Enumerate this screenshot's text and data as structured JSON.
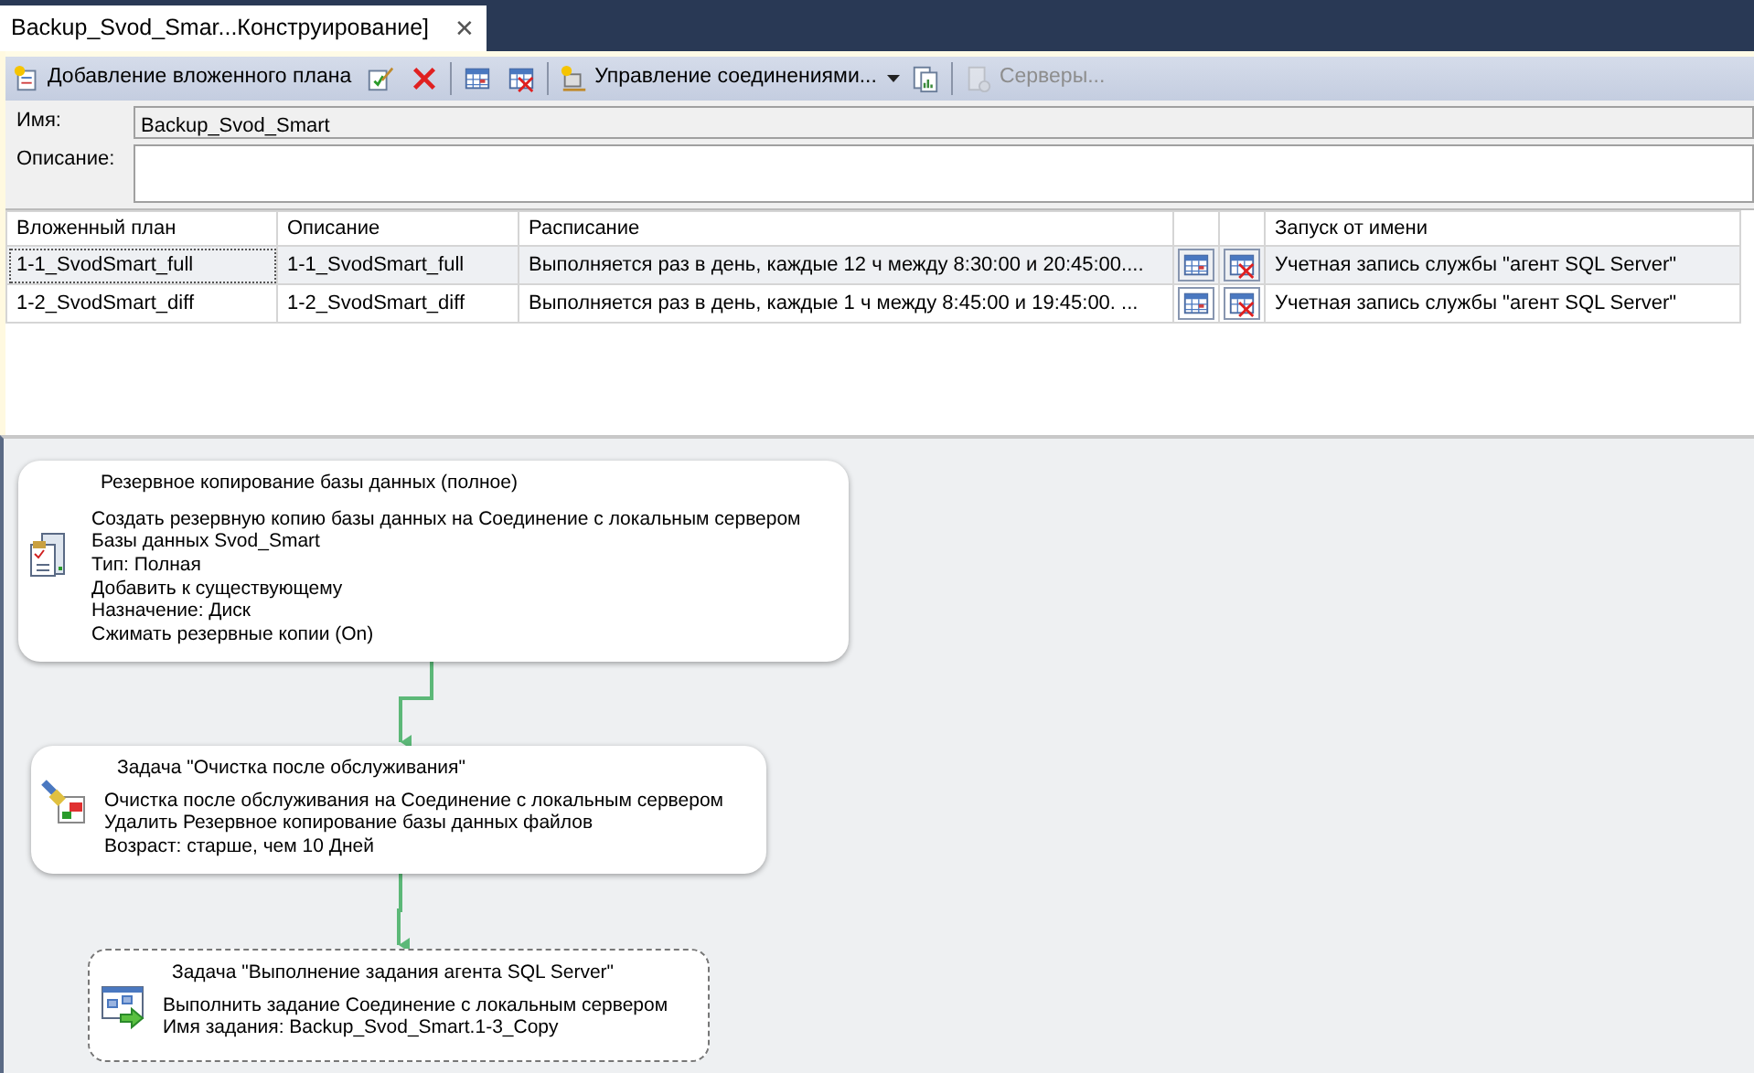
{
  "document_tab": {
    "title": "Backup_Svod_Smar...Конструирование]",
    "close": "✕",
    "selected": true
  },
  "toolbar": [
    {
      "kind": "labeled",
      "label": "Добавление вложенного плана",
      "disabled": false
    },
    {
      "kind": "icon",
      "disabled": false
    },
    {
      "kind": "icon",
      "disabled": false
    },
    {
      "kind": "separator"
    },
    {
      "kind": "icon",
      "disabled": false
    },
    {
      "kind": "icon",
      "disabled": false
    },
    {
      "kind": "separator"
    },
    {
      "kind": "dropdown",
      "label": "Управление соединениями...",
      "disabled": false
    },
    {
      "kind": "icon",
      "disabled": false
    },
    {
      "kind": "separator"
    },
    {
      "kind": "labeled",
      "label": "Серверы...",
      "disabled": true
    }
  ],
  "form": {
    "name_label": "Имя:",
    "name_value": "Backup_Svod_Smart",
    "description_label": "Описание:"
  },
  "table": {
    "columns": [
      "Вложенный план",
      "Описание",
      "Расписание",
      "Запуск от имени"
    ],
    "rows": [
      {
        "plan": "1-1_SvodSmart_full",
        "description": "1-1_SvodSmart_full",
        "schedule": "Выполняется раз в день, каждые 12 ч между 8:30:00 и 20:45:00....",
        "run_as": "Учетная запись службы \"агент SQL Server\"",
        "selected": true
      },
      {
        "plan": "1-2_SvodSmart_diff",
        "description": "1-2_SvodSmart_diff",
        "schedule": "Выполняется раз в день, каждые 1 ч между 8:45:00 и 19:45:00. ...",
        "run_as": "Учетная запись службы \"агент SQL Server\"",
        "selected": false
      }
    ]
  },
  "tasks": [
    {
      "kind": "backup",
      "title": "Резервное копирование базы данных (полное)",
      "lines": [
        "Создать резервную копию базы данных на Соединение с локальным сервером",
        "Базы данных Svod_Smart",
        "Тип: Полная",
        "Добавить к существующему",
        "Назначение: Диск",
        "Сжимать резервные копии (On)"
      ],
      "selected": false
    },
    {
      "kind": "cleanup",
      "title": "Задача \"Очистка после обслуживания\"",
      "lines": [
        "Очистка после обслуживания на Соединение с локальным сервером",
        "Удалить Резервное копирование базы данных файлов",
        "Возраст: старше, чем 10 Дней"
      ],
      "selected": false
    },
    {
      "kind": "agent-job",
      "title": "Задача \"Выполнение задания агента SQL Server\"",
      "lines": [
        "Выполнить задание Соединение с локальным сервером",
        "Имя задания: Backup_Svod_Smart.1-3_Copy"
      ],
      "selected": true
    }
  ]
}
